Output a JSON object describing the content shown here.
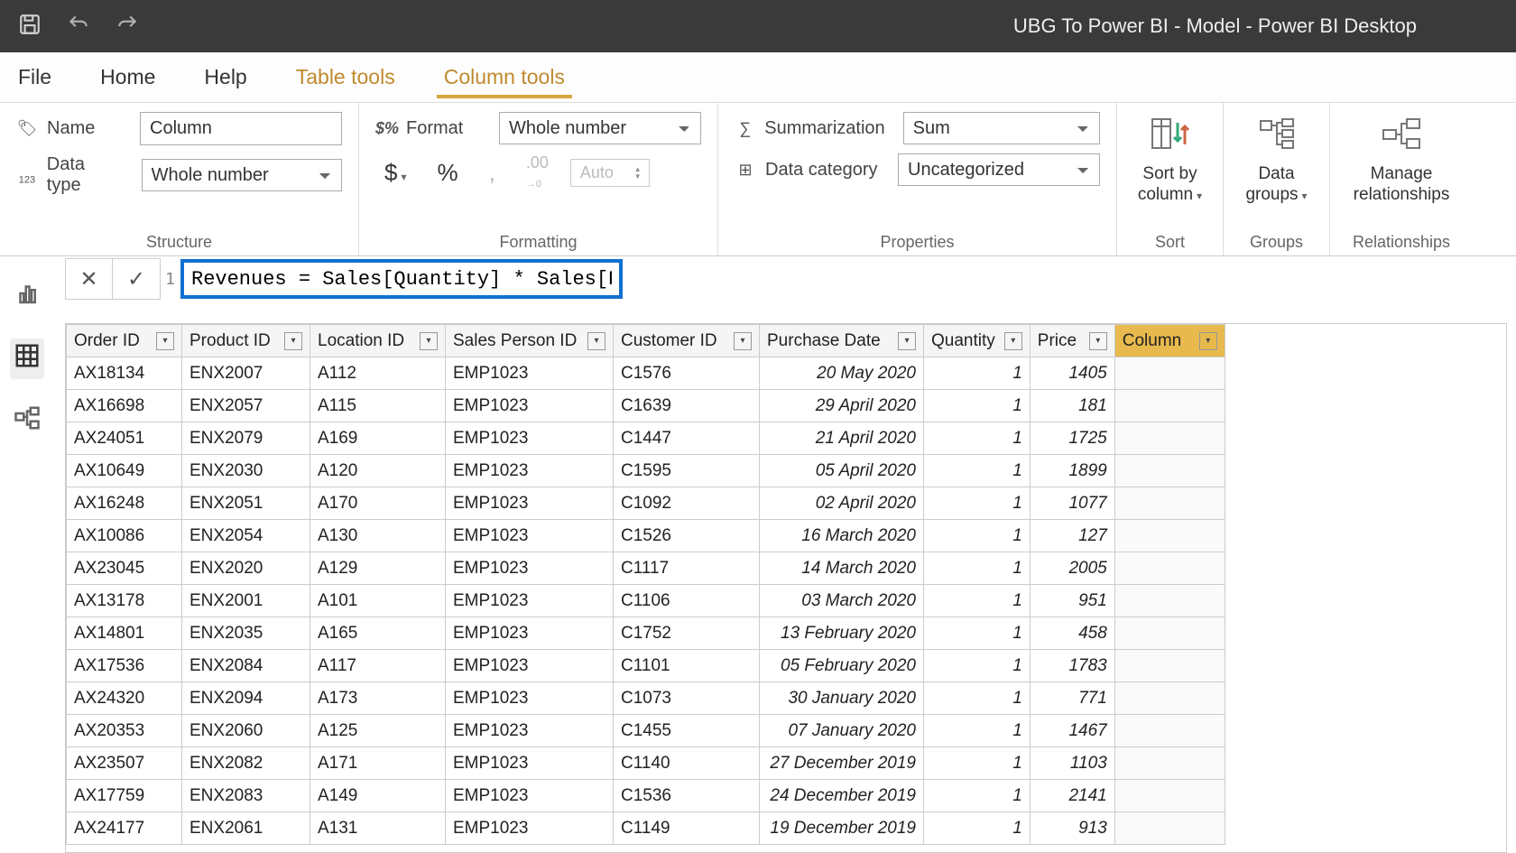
{
  "titlebar": {
    "title": "UBG To Power BI - Model - Power BI Desktop"
  },
  "tabs": {
    "file": "File",
    "home": "Home",
    "help": "Help",
    "tabletools": "Table tools",
    "columntools": "Column tools"
  },
  "structure": {
    "name_label": "Name",
    "name_value": "Column",
    "datatype_label": "Data type",
    "datatype_value": "Whole number",
    "group_label": "Structure"
  },
  "formatting": {
    "format_label": "Format",
    "format_value": "Whole number",
    "auto": "Auto",
    "group_label": "Formatting"
  },
  "properties": {
    "summarization_label": "Summarization",
    "summarization_value": "Sum",
    "datacategory_label": "Data category",
    "datacategory_value": "Uncategorized",
    "group_label": "Properties"
  },
  "buttons": {
    "sortby": "Sort by\ncolumn",
    "sort_label": "Sort",
    "datagroups": "Data\ngroups",
    "groups_label": "Groups",
    "manage": "Manage\nrelationships",
    "rel_label": "Relationships"
  },
  "formula": {
    "line": "1",
    "text": "Revenues = Sales[Quantity] * Sales[Price]"
  },
  "columns": {
    "orderid": "Order ID",
    "productid": "Product ID",
    "locationid": "Location ID",
    "salesperson": "Sales Person ID",
    "customerid": "Customer ID",
    "purchasedate": "Purchase Date",
    "quantity": "Quantity",
    "price": "Price",
    "column": "Column"
  },
  "rows": [
    {
      "orderid": "AX18134",
      "productid": "ENX2007",
      "locationid": "A112",
      "salesperson": "EMP1023",
      "customerid": "C1576",
      "purchasedate": "20 May 2020",
      "quantity": "1",
      "price": "1405"
    },
    {
      "orderid": "AX16698",
      "productid": "ENX2057",
      "locationid": "A115",
      "salesperson": "EMP1023",
      "customerid": "C1639",
      "purchasedate": "29 April 2020",
      "quantity": "1",
      "price": "181"
    },
    {
      "orderid": "AX24051",
      "productid": "ENX2079",
      "locationid": "A169",
      "salesperson": "EMP1023",
      "customerid": "C1447",
      "purchasedate": "21 April 2020",
      "quantity": "1",
      "price": "1725"
    },
    {
      "orderid": "AX10649",
      "productid": "ENX2030",
      "locationid": "A120",
      "salesperson": "EMP1023",
      "customerid": "C1595",
      "purchasedate": "05 April 2020",
      "quantity": "1",
      "price": "1899"
    },
    {
      "orderid": "AX16248",
      "productid": "ENX2051",
      "locationid": "A170",
      "salesperson": "EMP1023",
      "customerid": "C1092",
      "purchasedate": "02 April 2020",
      "quantity": "1",
      "price": "1077"
    },
    {
      "orderid": "AX10086",
      "productid": "ENX2054",
      "locationid": "A130",
      "salesperson": "EMP1023",
      "customerid": "C1526",
      "purchasedate": "16 March 2020",
      "quantity": "1",
      "price": "127"
    },
    {
      "orderid": "AX23045",
      "productid": "ENX2020",
      "locationid": "A129",
      "salesperson": "EMP1023",
      "customerid": "C1117",
      "purchasedate": "14 March 2020",
      "quantity": "1",
      "price": "2005"
    },
    {
      "orderid": "AX13178",
      "productid": "ENX2001",
      "locationid": "A101",
      "salesperson": "EMP1023",
      "customerid": "C1106",
      "purchasedate": "03 March 2020",
      "quantity": "1",
      "price": "951"
    },
    {
      "orderid": "AX14801",
      "productid": "ENX2035",
      "locationid": "A165",
      "salesperson": "EMP1023",
      "customerid": "C1752",
      "purchasedate": "13 February 2020",
      "quantity": "1",
      "price": "458"
    },
    {
      "orderid": "AX17536",
      "productid": "ENX2084",
      "locationid": "A117",
      "salesperson": "EMP1023",
      "customerid": "C1101",
      "purchasedate": "05 February 2020",
      "quantity": "1",
      "price": "1783"
    },
    {
      "orderid": "AX24320",
      "productid": "ENX2094",
      "locationid": "A173",
      "salesperson": "EMP1023",
      "customerid": "C1073",
      "purchasedate": "30 January 2020",
      "quantity": "1",
      "price": "771"
    },
    {
      "orderid": "AX20353",
      "productid": "ENX2060",
      "locationid": "A125",
      "salesperson": "EMP1023",
      "customerid": "C1455",
      "purchasedate": "07 January 2020",
      "quantity": "1",
      "price": "1467"
    },
    {
      "orderid": "AX23507",
      "productid": "ENX2082",
      "locationid": "A171",
      "salesperson": "EMP1023",
      "customerid": "C1140",
      "purchasedate": "27 December 2019",
      "quantity": "1",
      "price": "1103"
    },
    {
      "orderid": "AX17759",
      "productid": "ENX2083",
      "locationid": "A149",
      "salesperson": "EMP1023",
      "customerid": "C1536",
      "purchasedate": "24 December 2019",
      "quantity": "1",
      "price": "2141"
    },
    {
      "orderid": "AX24177",
      "productid": "ENX2061",
      "locationid": "A131",
      "salesperson": "EMP1023",
      "customerid": "C1149",
      "purchasedate": "19 December 2019",
      "quantity": "1",
      "price": "913"
    }
  ]
}
